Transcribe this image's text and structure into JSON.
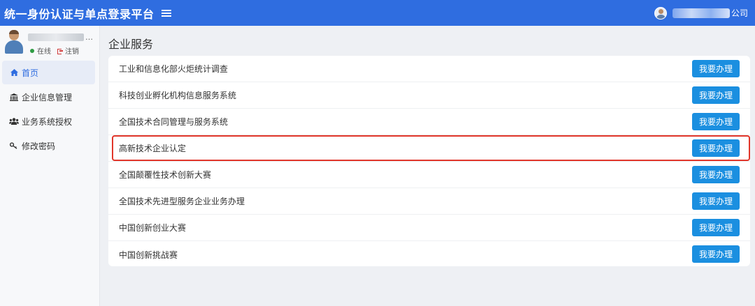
{
  "header": {
    "title": "统一身份认证与单点登录平台",
    "company_suffix": "公司"
  },
  "sidebar": {
    "status_online": "在线",
    "status_logout": "注销",
    "items": [
      {
        "label": "首页",
        "icon": "home-icon"
      },
      {
        "label": "企业信息管理",
        "icon": "bank-icon"
      },
      {
        "label": "业务系统授权",
        "icon": "users-icon"
      },
      {
        "label": "修改密码",
        "icon": "key-icon"
      }
    ]
  },
  "main": {
    "title": "企业服务",
    "action_label": "我要办理",
    "services": [
      {
        "name": "工业和信息化部火炬统计调查"
      },
      {
        "name": "科技创业孵化机构信息服务系统"
      },
      {
        "name": "全国技术合同管理与服务系统"
      },
      {
        "name": "高新技术企业认定"
      },
      {
        "name": "全国颠覆性技术创新大赛"
      },
      {
        "name": "全国技术先进型服务企业业务办理"
      },
      {
        "name": "中国创新创业大赛"
      },
      {
        "name": "中国创新挑战赛"
      }
    ]
  },
  "colors": {
    "topbar": "#2f6de0",
    "button": "#1b8fe0",
    "highlight": "#e1362a"
  }
}
